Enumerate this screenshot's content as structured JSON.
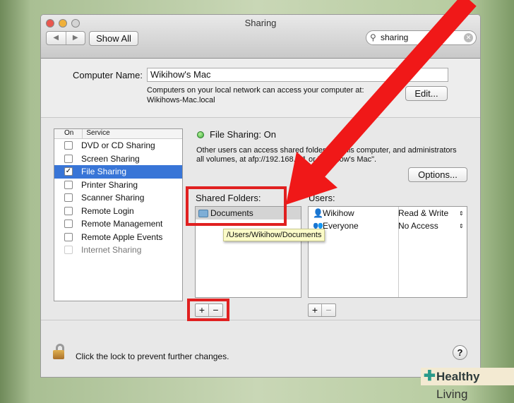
{
  "window": {
    "title": "Sharing",
    "show_all": "Show All",
    "search_value": "sharing",
    "back": "◀",
    "forward": "▶"
  },
  "computer": {
    "label": "Computer Name:",
    "value": "Wikihow's Mac",
    "desc": "Computers on your local network can access your computer at:",
    "local": "Wikihows-Mac.local",
    "edit": "Edit..."
  },
  "services": {
    "col_on": "On",
    "col_service": "Service",
    "items": [
      {
        "label": "DVD or CD Sharing",
        "on": false
      },
      {
        "label": "Screen Sharing",
        "on": false
      },
      {
        "label": "File Sharing",
        "on": true
      },
      {
        "label": "Printer Sharing",
        "on": false
      },
      {
        "label": "Scanner Sharing",
        "on": false
      },
      {
        "label": "Remote Login",
        "on": false
      },
      {
        "label": "Remote Management",
        "on": false
      },
      {
        "label": "Remote Apple Events",
        "on": false
      },
      {
        "label": "Internet Sharing",
        "on": false
      }
    ]
  },
  "status": {
    "title": "File Sharing: On",
    "color": "#3cb03c",
    "desc1": "Other users can access shared folders on this computer, and administrators",
    "desc2": "all volumes, at afp://192.168.1.1 or \"Wikihow's Mac\".",
    "options": "Options..."
  },
  "shared_folders": {
    "label": "Shared Folders:",
    "items": [
      "Documents"
    ],
    "tooltip": "/Users/Wikihow/Documents"
  },
  "users": {
    "label": "Users:",
    "items": [
      {
        "name": "Wikihow",
        "perm": "Read & Write"
      },
      {
        "name": "Everyone",
        "perm": "No Access"
      }
    ]
  },
  "buttons": {
    "add": "+",
    "remove": "−"
  },
  "lock": {
    "text": "Click the lock to prevent further changes."
  },
  "help": "?",
  "watermark": {
    "bold": "Healthy",
    "rest": " Living"
  }
}
